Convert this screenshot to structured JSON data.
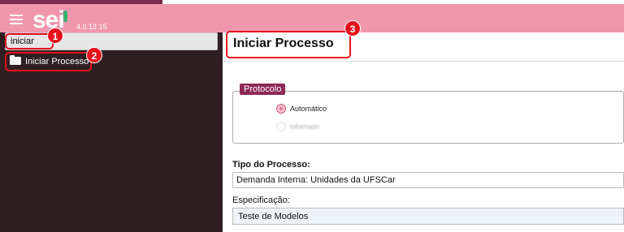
{
  "header": {
    "logo_text": "sei",
    "version": "4.0.12.15"
  },
  "sidebar": {
    "search_value": "iniciar",
    "items": [
      {
        "label": "Iniciar Processo",
        "icon": "folder-icon"
      }
    ]
  },
  "callouts": [
    "1",
    "2",
    "3"
  ],
  "main": {
    "title": "Iniciar Processo",
    "protocolo": {
      "legend": "Protocolo",
      "options": [
        {
          "label": "Automático",
          "selected": true
        },
        {
          "label": "Informado",
          "selected": false
        }
      ]
    },
    "tipo_processo": {
      "label": "Tipo do Processo:",
      "value": "Demanda Interna: Unidades da UFSCar"
    },
    "especificacao": {
      "label": "Especificação:",
      "value": "Teste de Modelos"
    }
  },
  "colors": {
    "topbar": "#f097ae",
    "sidebar": "#2f1f22",
    "legend": "#8e2a55",
    "callout": "#e8101c"
  }
}
